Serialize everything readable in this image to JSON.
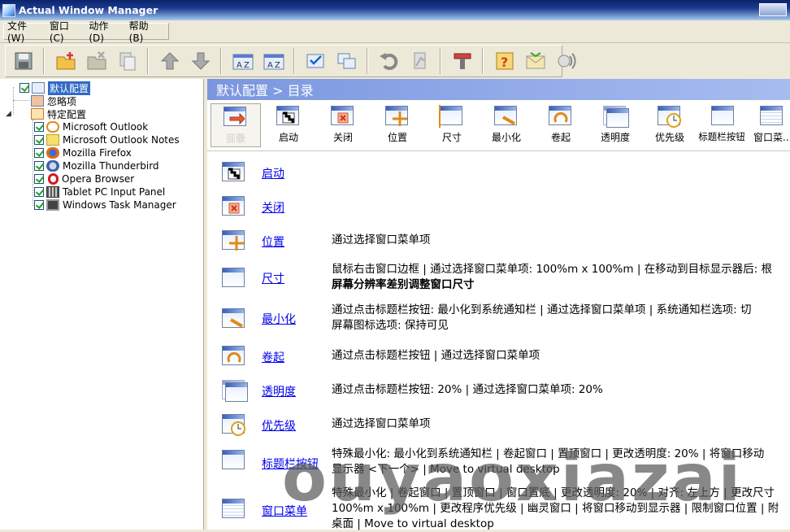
{
  "window": {
    "title": "Actual Window Manager"
  },
  "menu": [
    "文件(W)",
    "窗口(C)",
    "动作(D)",
    "帮助(B)"
  ],
  "toolbar_icons": [
    "save-icon",
    "new-folder-icon",
    "delete-icon",
    "copy-icon",
    "arrow-up-icon",
    "arrow-down-icon",
    "sort-az-icon",
    "sort-za-icon",
    "check-icon",
    "windows-icon",
    "undo-icon",
    "paste-icon",
    "tools-icon",
    "help-icon",
    "mail-icon",
    "speaker-icon"
  ],
  "tree": {
    "root": "默认配置",
    "ignore": "忽略项",
    "specific": "特定配置",
    "apps": [
      "Microsoft Outlook",
      "Microsoft Outlook Notes",
      "Mozilla Firefox",
      "Mozilla Thunderbird",
      "Opera Browser",
      "Tablet PC Input Panel",
      "Windows Task Manager"
    ]
  },
  "panel": {
    "header": "默认配置 > 目录",
    "tabs": [
      "目录",
      "启动",
      "关闭",
      "位置",
      "尺寸",
      "最小化",
      "卷起",
      "透明度",
      "优先级",
      "标题栏按钮",
      "窗口菜..."
    ]
  },
  "items": [
    {
      "link": "启动",
      "desc1": "",
      "desc2": ""
    },
    {
      "link": "关闭",
      "desc1": "",
      "desc2": ""
    },
    {
      "link": "位置",
      "desc1": "通过选择窗口菜单项",
      "desc2": ""
    },
    {
      "link": "尺寸",
      "desc1": "鼠标右击窗口边框 | 通过选择窗口菜单项: 100%m x 100%m | 在移动到目标显示器后: 根",
      "desc2": "屏幕分辨率差别调整窗口尺寸"
    },
    {
      "link": "最小化",
      "desc1": "通过点击标题栏按钮: 最小化到系统通知栏 | 通过选择窗口菜单项 | 系统通知栏选项: 切",
      "desc2": "屏幕图标选项: 保持可见"
    },
    {
      "link": "卷起",
      "desc1": "通过点击标题栏按钮 | 通过选择窗口菜单项",
      "desc2": ""
    },
    {
      "link": "透明度",
      "desc1": "通过点击标题栏按钮: 20% | 通过选择窗口菜单项: 20%",
      "desc2": ""
    },
    {
      "link": "优先级",
      "desc1": "通过选择窗口菜单项",
      "desc2": ""
    },
    {
      "link": "标题栏按钮",
      "desc1": "特殊最小化: 最小化到系统通知栏 | 卷起窗口 | 置顶窗口 | 更改透明度: 20% | 将窗口移动",
      "desc2": "显示器 <下一个> | Move to virtual desktop"
    },
    {
      "link": "窗口菜单",
      "desc1": "特殊最小化 | 卷起窗口 | 置顶窗口 | 窗口置底 | 更改透明度: 20% | 对齐: 左上方 | 更改尺寸",
      "desc2": "100%m x 100%m | 更改程序优先级 | 幽灵窗口 | 将窗口移动到显示器 | 限制窗口位置 | 附",
      "desc3": "桌面 | Move to virtual desktop"
    }
  ],
  "watermark": "ouyaoxiazai"
}
